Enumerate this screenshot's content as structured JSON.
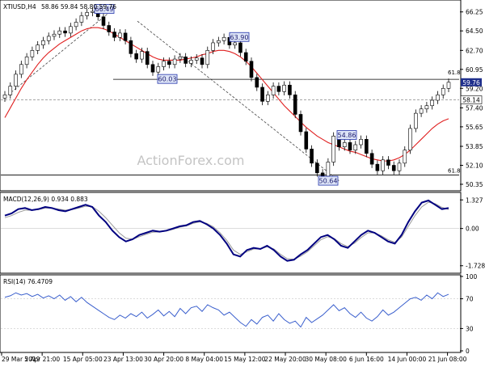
{
  "colors": {
    "price": "#000000",
    "sma": "#e02020",
    "macd": "#000080",
    "signal": "#9a9a9a",
    "rsi": "#3a5fcd",
    "box_fill": "#dde4f7",
    "box_border": "#2233aa",
    "current_price_bg": "#1f2f8c",
    "grid": "#c8c8c8"
  },
  "chart_data": [
    {
      "type": "candlestick",
      "title": "XTIUSD,H4",
      "ohlc": "58.86 59.84 58.80 59.76",
      "watermark": "ActionForex.com",
      "y_ticks": [
        "66.25",
        "64.50",
        "62.70",
        "60.95",
        "59.20",
        "57.40",
        "55.65",
        "53.85",
        "52.10",
        "50.35"
      ],
      "ylim": [
        49.9,
        67.2
      ],
      "x_ticks": [
        "29 Mar 2019",
        "5 Apr 21:00",
        "15 Apr 05:00",
        "23 Apr 13:00",
        "30 Apr 20:00",
        "8 May 04:00",
        "15 May 12:00",
        "22 May 20:00",
        "30 May 08:00",
        "6 Jun 16:00",
        "14 Jun 00:00",
        "21 Jun 08:00"
      ],
      "price_series": [
        58.6,
        59.4,
        60.5,
        61.4,
        62.1,
        62.7,
        63.2,
        63.6,
        64.0,
        64.2,
        64.5,
        64.3,
        64.9,
        65.3,
        65.9,
        66.2,
        66.3,
        65.8,
        65.0,
        64.4,
        63.9,
        64.3,
        63.6,
        62.4,
        61.9,
        62.6,
        61.4,
        60.7,
        61.2,
        61.7,
        61.4,
        61.9,
        62.1,
        61.5,
        61.8,
        62.0,
        61.4,
        62.7,
        63.4,
        63.6,
        63.9,
        63.2,
        63.4,
        62.5,
        61.7,
        60.2,
        59.3,
        58.0,
        58.6,
        59.4,
        58.9,
        59.5,
        58.6,
        56.8,
        55.2,
        53.6,
        52.3,
        51.4,
        51.1,
        52.4,
        54.8,
        53.8,
        54.2,
        53.5,
        54.0,
        54.5,
        53.2,
        52.2,
        51.6,
        52.6,
        52.1,
        51.6,
        52.3,
        53.5,
        55.5,
        56.9,
        57.3,
        57.6,
        58.1,
        58.6,
        59.2,
        59.76
      ],
      "sma_series": [
        56.5,
        57.4,
        58.3,
        59.2,
        60.0,
        60.7,
        61.4,
        62.0,
        62.5,
        62.9,
        63.3,
        63.6,
        63.9,
        64.2,
        64.5,
        64.7,
        64.8,
        64.8,
        64.7,
        64.5,
        64.2,
        63.9,
        63.6,
        63.3,
        63.0,
        62.7,
        62.4,
        62.1,
        61.9,
        61.8,
        61.8,
        61.8,
        61.8,
        61.9,
        62.0,
        62.1,
        62.3,
        62.4,
        62.6,
        62.7,
        62.7,
        62.6,
        62.4,
        62.1,
        61.7,
        61.2,
        60.6,
        60.0,
        59.4,
        58.8,
        58.2,
        57.6,
        57.1,
        56.6,
        56.1,
        55.6,
        55.2,
        54.8,
        54.5,
        54.2,
        54.0,
        53.8,
        53.6,
        53.4,
        53.3,
        53.1,
        52.9,
        52.7,
        52.6,
        52.5,
        52.5,
        52.6,
        52.8,
        53.1,
        53.5,
        54.0,
        54.5,
        55.0,
        55.5,
        55.9,
        56.2,
        56.4
      ],
      "labels": [
        {
          "text": "66.49",
          "value": 66.49
        },
        {
          "text": "63.90",
          "value": 63.9
        },
        {
          "text": "60.03",
          "value": 60.03
        },
        {
          "text": "54.86",
          "value": 54.86
        },
        {
          "text": "50.64",
          "value": 50.64
        }
      ],
      "fib_labels": [
        "61.8",
        "61.8"
      ],
      "current_price": "59.76",
      "level_price": "58.14"
    },
    {
      "type": "line",
      "title": "MACD(12,26,9) 0.934 0.883",
      "y_ticks": [
        "1.327",
        "0.00",
        "-1.728"
      ],
      "ylim": [
        -2.0,
        1.6
      ],
      "macd": [
        0.6,
        0.7,
        0.9,
        0.95,
        0.85,
        0.9,
        1.0,
        0.95,
        0.85,
        0.8,
        0.9,
        1.0,
        1.1,
        1.0,
        0.6,
        0.3,
        -0.1,
        -0.4,
        -0.6,
        -0.5,
        -0.3,
        -0.2,
        -0.1,
        -0.15,
        -0.1,
        0.0,
        0.1,
        0.15,
        0.3,
        0.35,
        0.2,
        0.0,
        -0.3,
        -0.7,
        -1.2,
        -1.3,
        -1.0,
        -0.9,
        -0.95,
        -0.8,
        -1.0,
        -1.3,
        -1.5,
        -1.45,
        -1.2,
        -1.0,
        -0.7,
        -0.4,
        -0.3,
        -0.5,
        -0.8,
        -0.9,
        -0.6,
        -0.3,
        -0.1,
        -0.2,
        -0.4,
        -0.6,
        -0.7,
        -0.3,
        0.3,
        0.8,
        1.2,
        1.3,
        1.1,
        0.9,
        0.95
      ],
      "signal": [
        0.5,
        0.6,
        0.75,
        0.85,
        0.85,
        0.88,
        0.95,
        0.95,
        0.9,
        0.85,
        0.88,
        0.95,
        1.03,
        1.02,
        0.8,
        0.5,
        0.15,
        -0.2,
        -0.45,
        -0.5,
        -0.38,
        -0.27,
        -0.17,
        -0.16,
        -0.12,
        -0.04,
        0.06,
        0.12,
        0.24,
        0.31,
        0.24,
        0.08,
        -0.2,
        -0.55,
        -1.0,
        -1.2,
        -1.08,
        -0.95,
        -0.95,
        -0.85,
        -0.95,
        -1.2,
        -1.4,
        -1.43,
        -1.28,
        -1.08,
        -0.8,
        -0.52,
        -0.38,
        -0.47,
        -0.7,
        -0.84,
        -0.68,
        -0.42,
        -0.2,
        -0.2,
        -0.34,
        -0.52,
        -0.64,
        -0.4,
        0.1,
        0.6,
        1.0,
        1.22,
        1.15,
        0.98,
        0.88
      ]
    },
    {
      "type": "line",
      "title": "RSI(14) 76.4709",
      "y_ticks": [
        "100",
        "70",
        "30",
        "0"
      ],
      "ylim": [
        0,
        100
      ],
      "rsi": [
        72,
        74,
        78,
        75,
        77,
        73,
        76,
        71,
        74,
        70,
        75,
        68,
        73,
        66,
        72,
        65,
        60,
        55,
        50,
        45,
        42,
        48,
        44,
        50,
        46,
        52,
        44,
        49,
        55,
        47,
        53,
        46,
        57,
        50,
        58,
        60,
        53,
        62,
        58,
        55,
        48,
        52,
        45,
        38,
        33,
        42,
        36,
        45,
        48,
        40,
        50,
        42,
        37,
        40,
        32,
        45,
        38,
        43,
        48,
        55,
        62,
        54,
        58,
        50,
        45,
        52,
        44,
        40,
        46,
        55,
        48,
        52,
        58,
        64,
        70,
        72,
        68,
        75,
        70,
        78,
        73,
        76
      ]
    }
  ]
}
